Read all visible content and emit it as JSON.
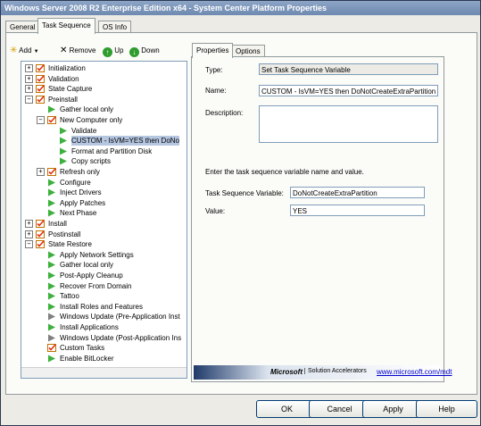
{
  "window": {
    "title": "Windows Server 2008 R2 Enterprise Edition x64 - System Center Platform Properties"
  },
  "outer_tabs": [
    "General",
    "Task Sequence",
    "OS Info"
  ],
  "toolbar": {
    "add": "Add",
    "remove": "Remove",
    "up": "Up",
    "down": "Down"
  },
  "tree": [
    {
      "label": "Initialization",
      "level": 0,
      "type": "group",
      "expander": "+"
    },
    {
      "label": "Validation",
      "level": 0,
      "type": "group",
      "expander": "+"
    },
    {
      "label": "State Capture",
      "level": 0,
      "type": "group",
      "expander": "+"
    },
    {
      "label": "Preinstall",
      "level": 0,
      "type": "group",
      "expander": "-"
    },
    {
      "label": "Gather local only",
      "level": 1,
      "type": "step"
    },
    {
      "label": "New Computer only",
      "level": 1,
      "type": "group",
      "expander": "-"
    },
    {
      "label": "Validate",
      "level": 2,
      "type": "step"
    },
    {
      "label": "CUSTOM - IsVM=YES then DoNo",
      "level": 2,
      "type": "step",
      "selected": true
    },
    {
      "label": "Format and Partition Disk",
      "level": 2,
      "type": "step"
    },
    {
      "label": "Copy scripts",
      "level": 2,
      "type": "step"
    },
    {
      "label": "Refresh only",
      "level": 1,
      "type": "group",
      "expander": "+"
    },
    {
      "label": "Configure",
      "level": 1,
      "type": "step"
    },
    {
      "label": "Inject Drivers",
      "level": 1,
      "type": "step"
    },
    {
      "label": "Apply Patches",
      "level": 1,
      "type": "step"
    },
    {
      "label": "Next Phase",
      "level": 1,
      "type": "step"
    },
    {
      "label": "Install",
      "level": 0,
      "type": "group",
      "expander": "+"
    },
    {
      "label": "Postinstall",
      "level": 0,
      "type": "group",
      "expander": "+"
    },
    {
      "label": "State Restore",
      "level": 0,
      "type": "group",
      "expander": "-"
    },
    {
      "label": "Apply Network Settings",
      "level": 1,
      "type": "step"
    },
    {
      "label": "Gather local only",
      "level": 1,
      "type": "step"
    },
    {
      "label": "Post-Apply Cleanup",
      "level": 1,
      "type": "step"
    },
    {
      "label": "Recover From Domain",
      "level": 1,
      "type": "step"
    },
    {
      "label": "Tattoo",
      "level": 1,
      "type": "step"
    },
    {
      "label": "Install Roles and Features",
      "level": 1,
      "type": "step"
    },
    {
      "label": "Windows Update (Pre-Application Inst",
      "level": 1,
      "type": "step-disabled"
    },
    {
      "label": "Install Applications",
      "level": 1,
      "type": "step"
    },
    {
      "label": "Windows Update (Post-Application Ins",
      "level": 1,
      "type": "step-disabled"
    },
    {
      "label": "Custom Tasks",
      "level": 1,
      "type": "group"
    },
    {
      "label": "Enable BitLocker",
      "level": 1,
      "type": "step"
    }
  ],
  "inner_tabs": [
    "Properties",
    "Options"
  ],
  "properties": {
    "type_label": "Type:",
    "type_value": "Set Task Sequence Variable",
    "name_label": "Name:",
    "name_value": "CUSTOM - IsVM=YES then DoNotCreateExtraPartition",
    "description_label": "Description:",
    "description_value": "",
    "instructions": "Enter the task sequence variable name and value.",
    "variable_label": "Task Sequence Variable:",
    "variable_value": "DoNotCreateExtraPartition",
    "value_label": "Value:",
    "value_value": "YES"
  },
  "banner": {
    "brand": "Microsoft",
    "product": "Solution Accelerators",
    "link": "www.microsoft.com/mdt"
  },
  "buttons": {
    "ok": "OK",
    "cancel": "Cancel",
    "apply": "Apply",
    "help": "Help"
  },
  "colors": {
    "selection": "#b5c6e0",
    "check_icon": "#f0a020",
    "step_icon": "#3db03d",
    "disabled_icon": "#808080",
    "link": "#0000cc"
  }
}
